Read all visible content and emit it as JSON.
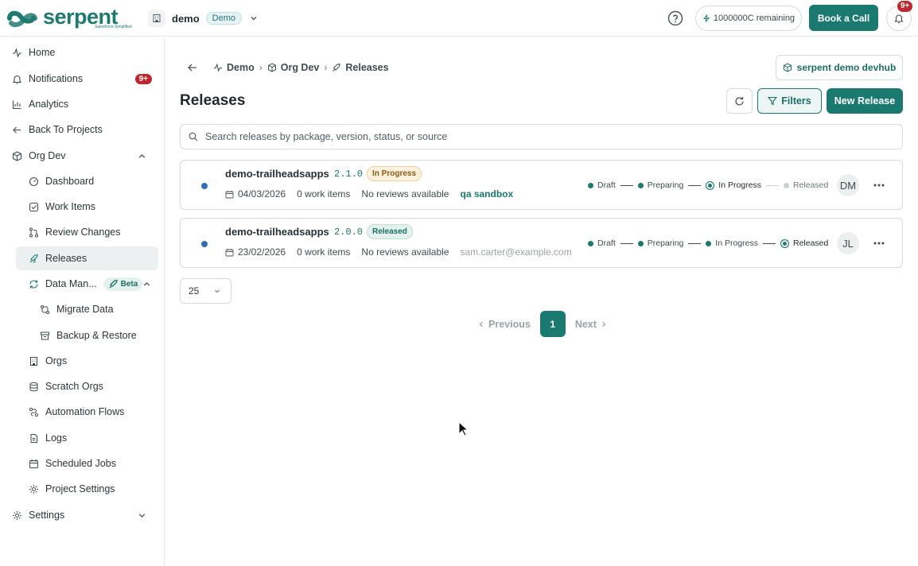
{
  "brand": {
    "name": "serpent",
    "tagline": "Salesforce Simplified",
    "color": "#1a7a6f"
  },
  "workspace": {
    "name": "demo",
    "badge": "Demo"
  },
  "header": {
    "credits": "1000000C remaining",
    "book_call": "Book a Call",
    "notifications_badge": "9+"
  },
  "sidebar": {
    "home": "Home",
    "notifications": "Notifications",
    "notifications_badge": "9+",
    "analytics": "Analytics",
    "back_to_projects": "Back To Projects",
    "org_dev": "Org Dev",
    "dashboard": "Dashboard",
    "work_items": "Work Items",
    "review_changes": "Review Changes",
    "releases": "Releases",
    "data_man": "Data Man...",
    "beta": "Beta",
    "migrate_data": "Migrate Data",
    "backup_restore": "Backup & Restore",
    "orgs": "Orgs",
    "scratch_orgs": "Scratch Orgs",
    "automation_flows": "Automation Flows",
    "logs": "Logs",
    "scheduled_jobs": "Scheduled Jobs",
    "project_settings": "Project Settings",
    "settings": "Settings"
  },
  "breadcrumb": {
    "demo": "Demo",
    "org_dev": "Org Dev",
    "releases": "Releases"
  },
  "devhub": "serpent demo devhub",
  "page": {
    "title": "Releases",
    "filters": "Filters",
    "new_release": "New Release",
    "search_placeholder": "Search releases by package, version, status, or source"
  },
  "releases": [
    {
      "name": "demo-trailheadsapps",
      "version": "2.1.0",
      "status": "In Progress",
      "date": "04/03/2026",
      "work_items": "0 work items",
      "reviews": "No reviews available",
      "source": "qa sandbox",
      "steps": [
        "Draft",
        "Preparing",
        "In Progress",
        "Released"
      ],
      "current_step": "In Progress",
      "avatar": "DM"
    },
    {
      "name": "demo-trailheadsapps",
      "version": "2.0.0",
      "status": "Released",
      "date": "23/02/2026",
      "work_items": "0 work items",
      "reviews": "No reviews available",
      "source": "sam.carter@example.com",
      "steps": [
        "Draft",
        "Preparing",
        "In Progress",
        "Released"
      ],
      "current_step": "Released",
      "avatar": "JL"
    }
  ],
  "pagination": {
    "page_size": "25",
    "previous": "Previous",
    "current": "1",
    "next": "Next"
  }
}
